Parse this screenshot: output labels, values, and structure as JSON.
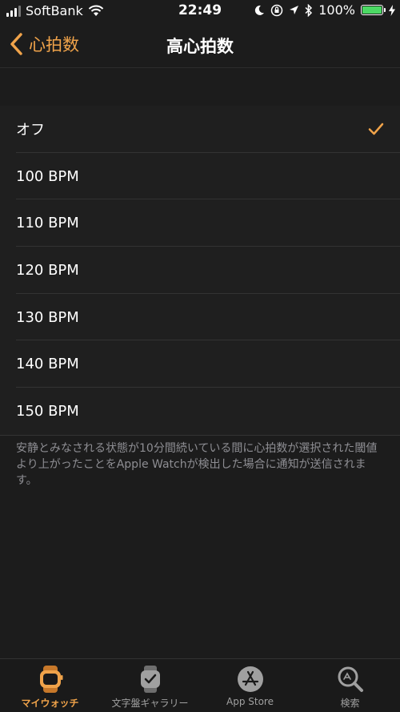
{
  "status_bar": {
    "carrier": "SoftBank",
    "time": "22:49",
    "battery": "100%"
  },
  "nav": {
    "back_label": "心拍数",
    "title": "高心拍数"
  },
  "options": [
    {
      "label": "オフ",
      "selected": true
    },
    {
      "label": "100 BPM",
      "selected": false
    },
    {
      "label": "110 BPM",
      "selected": false
    },
    {
      "label": "120 BPM",
      "selected": false
    },
    {
      "label": "130 BPM",
      "selected": false
    },
    {
      "label": "140 BPM",
      "selected": false
    },
    {
      "label": "150 BPM",
      "selected": false
    }
  ],
  "footnote": "安静とみなされる状態が10分間続いている間に心拍数が選択された閾値より上がったことをApple Watchが検出した場合に通知が送信されます。",
  "tabs": [
    {
      "label": "マイウォッチ",
      "icon": "my-watch-icon",
      "active": true
    },
    {
      "label": "文字盤ギャラリー",
      "icon": "face-gallery-icon",
      "active": false
    },
    {
      "label": "App Store",
      "icon": "app-store-icon",
      "active": false
    },
    {
      "label": "検索",
      "icon": "search-icon",
      "active": false
    }
  ],
  "colors": {
    "accent": "#f0a34a",
    "background": "#1c1c1c",
    "battery_green": "#4cd964"
  }
}
